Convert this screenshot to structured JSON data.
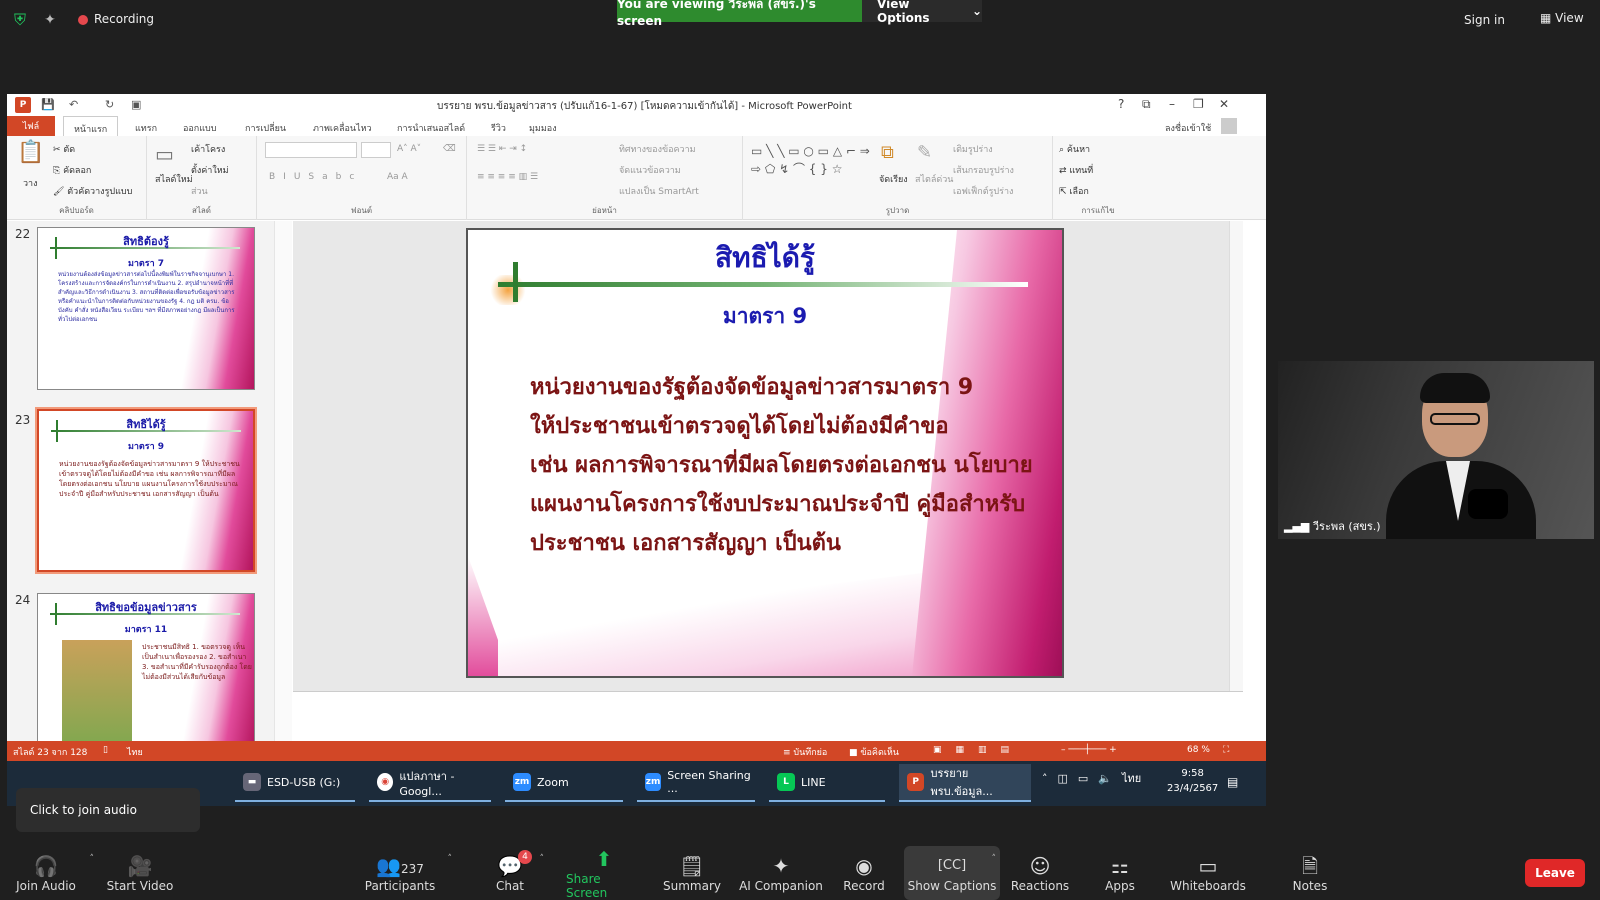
{
  "zoom_top": {
    "recording_label": "Recording",
    "viewing_banner": "You are viewing วีระพล (สขร.)'s screen",
    "view_options_label": "View Options",
    "sign_in_label": "Sign in",
    "view_label": "View"
  },
  "ppt": {
    "window_title": "บรรยาย พรบ.ข้อมูลข่าวสาร (ปรับแก้16-1-67) [โหมดความเข้ากันได้] - Microsoft PowerPoint",
    "tabs": [
      "ไฟล์",
      "หน้าแรก",
      "แทรก",
      "ออกแบบ",
      "การเปลี่ยน",
      "ภาพเคลื่อนไหว",
      "การนำเสนอสไลด์",
      "รีวิว",
      "มุมมอง"
    ],
    "signin_label": "ลงชื่อเข้าใช้",
    "ribbon": {
      "clipboard_label": "คลิปบอร์ด",
      "paste_label": "วาง",
      "cut_label": "ตัด",
      "copy_label": "คัดลอก",
      "format_painter_label": "ตัวคัดวางรูปแบบ",
      "slides_label": "สไลด์",
      "new_slide_label": "สไลด์ใหม่",
      "layout_label": "เค้าโครง",
      "reset_label": "ตั้งค่าใหม่",
      "section_label": "ส่วน",
      "font_label": "ฟอนต์",
      "paragraph_label": "ย่อหน้า",
      "text_direction_label": "ทิศทางของข้อความ",
      "align_text_label": "จัดแนวข้อความ",
      "smartart_label": "แปลงเป็น SmartArt",
      "drawing_label": "รูปวาด",
      "arrange_label": "จัดเรียง",
      "quick_styles_label": "สไตล์ด่วน",
      "shape_fill_label": "เติมรูปร่าง",
      "shape_outline_label": "เส้นกรอบรูปร่าง",
      "shape_effects_label": "เอฟเฟ็กต์รูปร่าง",
      "editing_label": "การแก้ไข",
      "find_label": "ค้นหา",
      "replace_label": "แทนที่",
      "select_label": "เลือก"
    },
    "thumbnails": [
      {
        "number": "22",
        "title": "สิทธิต้องรู้",
        "subtitle": "มาตรา 7",
        "body": "หน่วยงานต้องส่งข้อมูลข่าวสารต่อไปนี้ลงพิมพ์ในราชกิจจานุเบกษา 1. โครงสร้างและการจัดองค์กรในการดำเนินงาน 2. สรุปอำนาจหน้าที่ที่สำคัญและวิธีการดำเนินงาน 3. สถานที่ติดต่อเพื่อขอรับข้อมูลข่าวสารหรือคำแนะนำในการติดต่อกับหน่วยงานของรัฐ 4. กฎ มติ ครม. ข้อบังคับ คำสั่ง หนังสือเวียน ระเบียบ ฯลฯ ที่มีสภาพอย่างกฎ มีผลเป็นการทั่วไปต่อเอกชน"
      },
      {
        "number": "23",
        "title": "สิทธิได้รู้",
        "subtitle": "มาตรา 9",
        "body": "หน่วยงานของรัฐต้องจัดข้อมูลข่าวสารมาตรา 9 ให้ประชาชนเข้าตรวจดูได้โดยไม่ต้องมีคำขอ เช่น ผลการพิจารณาที่มีผลโดยตรงต่อเอกชน นโยบาย แผนงานโครงการใช้งบประมาณประจำปี คู่มือสำหรับประชาชน เอกสารสัญญา เป็นต้น"
      },
      {
        "number": "24",
        "title": "สิทธิขอข้อมูลข่าวสาร",
        "subtitle": "มาตรา 11",
        "body": "ประชาชนมีสิทธิ 1. ขอตรวจดู เห็นเป็นสำเนาเพื่อรองรอง 2. ขอสำเนา 3. ขอสำเนาที่มีคำรับรองถูกต้อง โดยไม่ต้องมีส่วนได้เสียกับข้อมูล"
      }
    ],
    "slide": {
      "title": "สิทธิได้รู้",
      "subtitle": "มาตรา 9",
      "body_lines": [
        "หน่วยงานของรัฐต้องจัดข้อมูลข่าวสารมาตรา 9",
        "ให้ประชาชนเข้าตรวจดูได้โดยไม่ต้องมีคำขอ",
        "เช่น ผลการพิจารณาที่มีผลโดยตรงต่อเอกชน นโยบาย",
        "แผนงานโครงการใช้งบประมาณประจำปี คู่มือสำหรับ",
        "ประชาชน เอกสารสัญญา เป็นต้น"
      ]
    },
    "status": {
      "slide_counter": "สไลด์ 23 จาก 128",
      "language": "ไทย",
      "notes_label": "บันทึกย่อ",
      "comments_label": "ข้อคิดเห็น",
      "zoom_level": "68 %"
    }
  },
  "taskbar": {
    "items": [
      "ESD-USB (G:)",
      "แปลภาษา - Googl...",
      "Zoom",
      "Screen Sharing ...",
      "LINE",
      "บรรยาย พรบ.ข้อมูล..."
    ],
    "language": "ไทย",
    "time": "9:58",
    "date": "23/4/2567"
  },
  "video": {
    "participant_name": "วีระพล (สขร.)"
  },
  "join_audio_tip": "Click to join audio",
  "toolbar": {
    "join_audio": "Join Audio",
    "start_video": "Start Video",
    "participants": "Participants",
    "participants_count": "237",
    "chat": "Chat",
    "chat_badge": "4",
    "share_screen": "Share Screen",
    "summary": "Summary",
    "ai_companion": "AI Companion",
    "record": "Record",
    "show_captions": "Show Captions",
    "reactions": "Reactions",
    "apps": "Apps",
    "whiteboards": "Whiteboards",
    "notes": "Notes",
    "leave": "Leave"
  },
  "colors": {
    "zoom_green": "#2e8b2e",
    "ppt_orange": "#d24726",
    "leave_red": "#e02828",
    "slide_title_blue": "#1b1bb0",
    "slide_body_maroon": "#7b1414"
  }
}
